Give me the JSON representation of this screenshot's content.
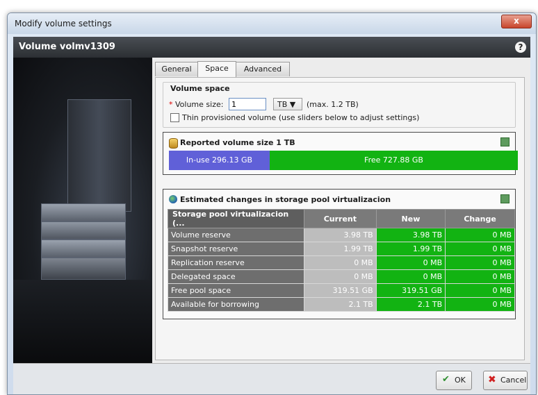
{
  "window": {
    "title": "Modify volume settings",
    "close_label": "x"
  },
  "header": {
    "title": "Volume volmv1309",
    "help_icon": "?"
  },
  "tabs": [
    {
      "label": "General",
      "active": false
    },
    {
      "label": "Space",
      "active": true
    },
    {
      "label": "Advanced",
      "active": false
    }
  ],
  "volume_space": {
    "legend": "Volume space",
    "required_mark": "*",
    "size_label": "Volume size:",
    "size_value": "1",
    "unit": "TB",
    "unit_arrow": "▼",
    "max_text": "(max. 1.2 TB)",
    "thin_label": "Thin provisioned volume (use sliders below to adjust settings)",
    "thin_checked": false
  },
  "reported": {
    "title": "Reported volume size 1 TB",
    "inuse_label": "In-use 296.13 GB",
    "free_label": "Free 727.88 GB",
    "inuse_fraction": 0.289,
    "inuse_color": "#6060d8",
    "free_color": "#12b312"
  },
  "estimated": {
    "title": "Estimated changes in storage pool virtualizacion",
    "columns": [
      "Storage pool virtualizacion (...",
      "Current",
      "New",
      "Change"
    ],
    "rows": [
      {
        "name": "Volume reserve",
        "current": "3.98 TB",
        "new": "3.98 TB",
        "change": "0 MB"
      },
      {
        "name": "Snapshot reserve",
        "current": "1.99 TB",
        "new": "1.99 TB",
        "change": "0 MB"
      },
      {
        "name": "Replication reserve",
        "current": "0 MB",
        "new": "0 MB",
        "change": "0 MB"
      },
      {
        "name": "Delegated space",
        "current": "0 MB",
        "new": "0 MB",
        "change": "0 MB"
      },
      {
        "name": "Free pool space",
        "current": "319.51 GB",
        "new": "319.51 GB",
        "change": "0 MB"
      },
      {
        "name": "Available for borrowing",
        "current": "2.1 TB",
        "new": "2.1 TB",
        "change": "0 MB"
      }
    ]
  },
  "footer": {
    "ok_label": "OK",
    "cancel_label": "Cancel"
  }
}
